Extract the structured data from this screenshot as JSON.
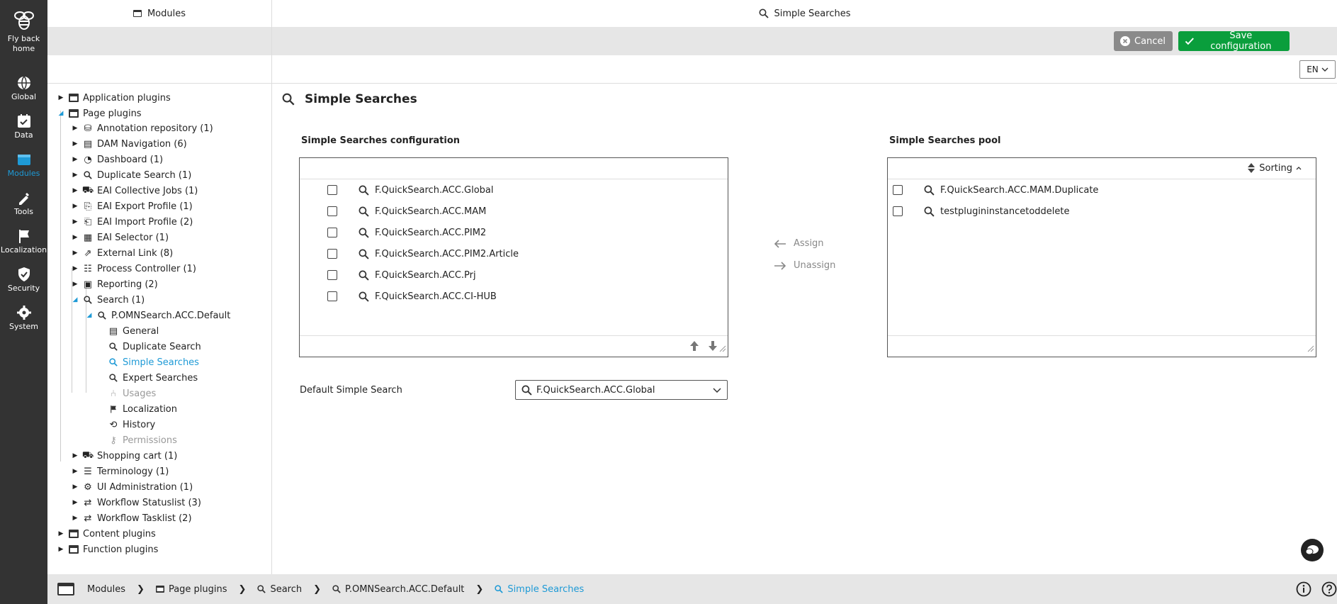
{
  "rail": {
    "home_label": "Fly back home",
    "items": [
      {
        "label": "Global",
        "icon": "globe-icon"
      },
      {
        "label": "Data",
        "icon": "data-icon"
      },
      {
        "label": "Modules",
        "icon": "modules-icon",
        "active": true
      },
      {
        "label": "Tools",
        "icon": "tools-icon"
      },
      {
        "label": "Localization",
        "icon": "flag-icon"
      },
      {
        "label": "Security",
        "icon": "shield-icon"
      },
      {
        "label": "System",
        "icon": "gear-icon"
      }
    ]
  },
  "header": {
    "left_title": "Modules",
    "right_title": "Simple Searches"
  },
  "toolbar": {
    "cancel_label": "Cancel",
    "save_label": "Save configuration"
  },
  "language": "EN",
  "tree": {
    "application_plugins": "Application plugins",
    "page_plugins": "Page plugins",
    "annotation_repository": "Annotation repository (1)",
    "dam_navigation": "DAM Navigation (6)",
    "dashboard": "Dashboard (1)",
    "duplicate_search": "Duplicate Search (1)",
    "eai_collective_jobs": "EAI Collective Jobs (1)",
    "eai_export_profile": "EAI Export Profile (1)",
    "eai_import_profile": "EAI Import Profile (2)",
    "eai_selector": "EAI Selector (1)",
    "external_link": "External Link (8)",
    "process_controller": "Process Controller (1)",
    "reporting": "Reporting (2)",
    "search": "Search (1)",
    "search_instance": "P.OMNSearch.ACC.Default",
    "general": "General",
    "duplicate_search_child": "Duplicate Search",
    "simple_searches": "Simple Searches",
    "expert_searches": "Expert Searches",
    "usages": "Usages",
    "localization": "Localization",
    "history": "History",
    "permissions": "Permissions",
    "shopping_cart": "Shopping cart (1)",
    "terminology": "Terminology (1)",
    "ui_administration": "UI Administration (1)",
    "workflow_statuslist": "Workflow Statuslist (3)",
    "workflow_tasklist": "Workflow Tasklist (2)",
    "content_plugins": "Content plugins",
    "function_plugins": "Function plugins"
  },
  "main": {
    "title": "Simple Searches",
    "config_title": "Simple Searches configuration",
    "pool_title": "Simple Searches pool",
    "config_items": [
      "F.QuickSearch.ACC.Global",
      "F.QuickSearch.ACC.MAM",
      "F.QuickSearch.ACC.PIM2",
      "F.QuickSearch.ACC.PIM2.Article",
      "F.QuickSearch.ACC.Prj",
      "F.QuickSearch.ACC.CI-HUB"
    ],
    "pool_items": [
      "F.QuickSearch.ACC.MAM.Duplicate",
      "testplugininstancetoddelete"
    ],
    "sorting_label": "Sorting",
    "assign_label": "Assign",
    "unassign_label": "Unassign",
    "default_label": "Default Simple Search",
    "default_value": "F.QuickSearch.ACC.Global"
  },
  "breadcrumb": [
    "Modules",
    "Page plugins",
    "Search",
    "P.OMNSearch.ACC.Default",
    "Simple Searches"
  ],
  "colors": {
    "accent": "#1e9ad6",
    "save": "#0a9e3c",
    "rail": "#333333"
  }
}
